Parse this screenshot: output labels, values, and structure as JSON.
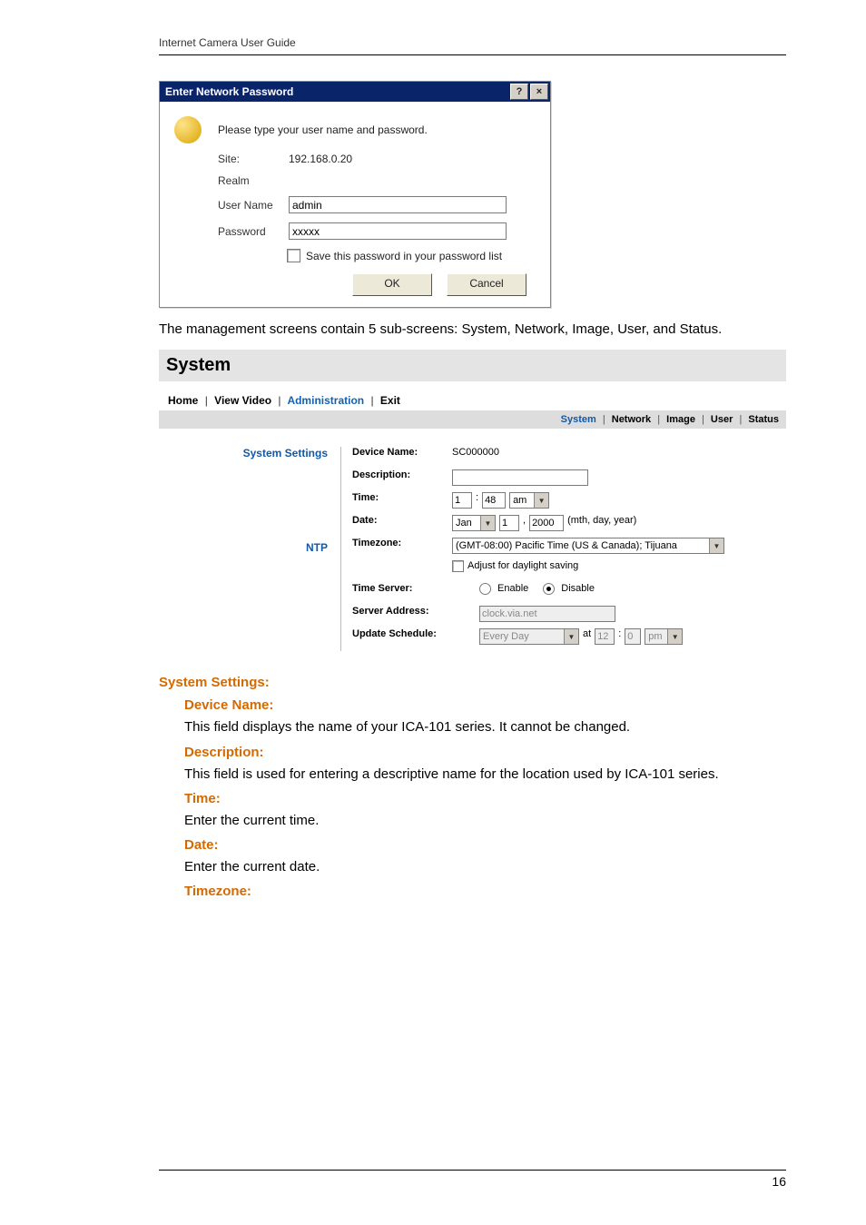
{
  "doc_header": "Internet Camera User Guide",
  "dialog": {
    "title": "Enter Network Password",
    "help_btn": "?",
    "close_btn": "×",
    "prompt": "Please type your user name and password.",
    "rows": {
      "site_label": "Site:",
      "site_value": "192.168.0.20",
      "realm_label": "Realm",
      "realm_value": "",
      "username_label": "User Name",
      "username_value": "admin",
      "password_label": "Password",
      "password_value": "xxxxx"
    },
    "checkbox_label": "Save this password in your password list",
    "ok_label": "OK",
    "cancel_label": "Cancel"
  },
  "intro_text": "The management screens contain 5 sub-screens: System, Network, Image, User, and Status.",
  "section_title": "System",
  "admin": {
    "topnav": {
      "home": "Home",
      "view_video": "View Video",
      "administration": "Administration",
      "exit": "Exit"
    },
    "subnav": {
      "system": "System",
      "network": "Network",
      "image": "Image",
      "user": "User",
      "status": "Status"
    },
    "groups": {
      "system_settings": "System Settings",
      "ntp": "NTP"
    },
    "labels": {
      "device_name": "Device Name:",
      "description": "Description:",
      "time": "Time:",
      "date": "Date:",
      "timezone": "Timezone:",
      "time_server": "Time Server:",
      "server_address": "Server Address:",
      "update_schedule": "Update Schedule:"
    },
    "values": {
      "device_name": "SC000000",
      "description": "",
      "time_hr": "1",
      "time_min": "48",
      "time_ampm": "am",
      "date_month": "Jan",
      "date_day": "1",
      "date_year": "2000",
      "date_hint": "(mth, day, year)",
      "timezone": "(GMT-08:00) Pacific Time (US & Canada); Tijuana",
      "dst_label": "Adjust for daylight saving",
      "ts_enable": "Enable",
      "ts_disable": "Disable",
      "server_address": "clock.via.net",
      "update_day": "Every Day",
      "at_label": "at",
      "update_hr": "12",
      "update_min": "0",
      "update_ampm": "pm"
    }
  },
  "doc_sections": {
    "system_settings_h": "System Settings:",
    "device_name_h": "Device Name:",
    "device_name_p": "This field displays the name of your ICA-101 series. It cannot be changed.",
    "description_h": "Description:",
    "description_p": "This field is used for entering a descriptive name for the location used by ICA-101 series.",
    "time_h": "Time:",
    "time_p": "Enter the current time.",
    "date_h": "Date:",
    "date_p": "Enter the current date.",
    "timezone_h": "Timezone:"
  },
  "page_number": "16"
}
